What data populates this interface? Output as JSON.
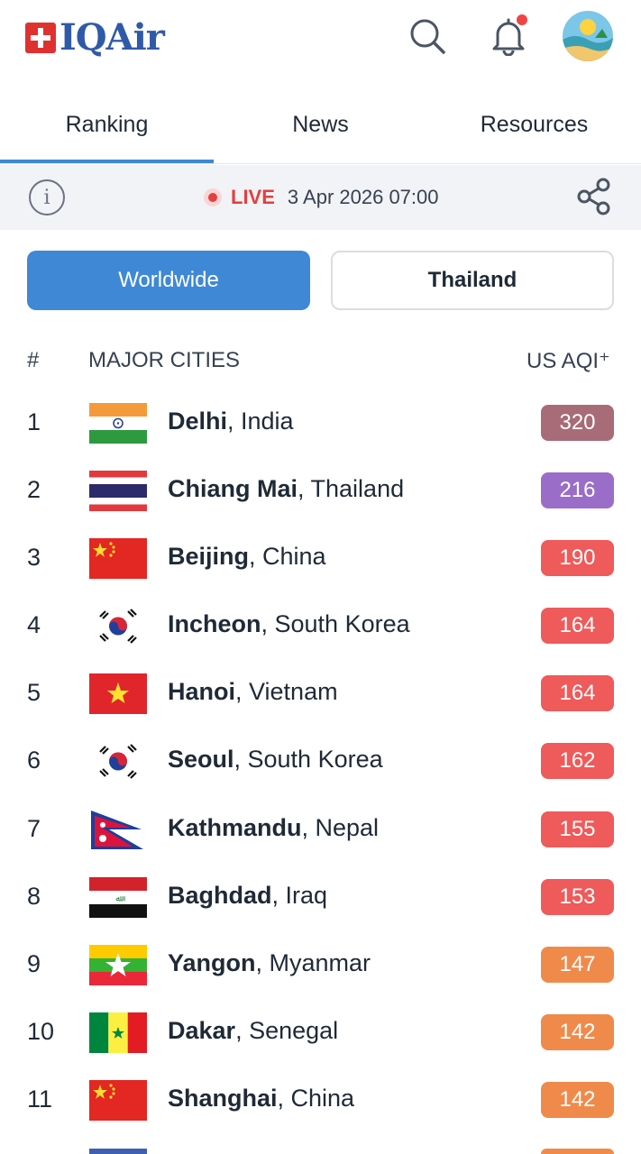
{
  "app": {
    "brand": "IQAir"
  },
  "header": {
    "icons": [
      "search-icon",
      "bell-icon",
      "avatar"
    ],
    "notification_dot_color": "#ef4444"
  },
  "tabs": [
    {
      "label": "Ranking",
      "active": true
    },
    {
      "label": "News",
      "active": false
    },
    {
      "label": "Resources",
      "active": false
    }
  ],
  "status": {
    "live_label": "LIVE",
    "timestamp": "3 Apr 2026 07:00"
  },
  "segment": {
    "worldwide": "Worldwide",
    "country": "Thailand",
    "selected": "Worldwide"
  },
  "table": {
    "col_rank": "#",
    "col_city": "MAJOR CITIES",
    "col_aqi": "US AQI⁺",
    "rows": [
      {
        "rank": "1",
        "city": "Delhi",
        "country": ", India",
        "aqi": "320",
        "flag": "india",
        "color": "#a86b78"
      },
      {
        "rank": "2",
        "city": "Chiang Mai",
        "country": ", Thailand",
        "aqi": "216",
        "flag": "thailand",
        "color": "#9a6dc9"
      },
      {
        "rank": "3",
        "city": "Beijing",
        "country": ", China",
        "aqi": "190",
        "flag": "china",
        "color": "#ef5a5a"
      },
      {
        "rank": "4",
        "city": "Incheon",
        "country": ", South Korea",
        "aqi": "164",
        "flag": "south-korea",
        "color": "#ef5a5a"
      },
      {
        "rank": "5",
        "city": "Hanoi",
        "country": ", Vietnam",
        "aqi": "164",
        "flag": "vietnam",
        "color": "#ef5a5a"
      },
      {
        "rank": "6",
        "city": "Seoul",
        "country": ", South Korea",
        "aqi": "162",
        "flag": "south-korea",
        "color": "#ef5a5a"
      },
      {
        "rank": "7",
        "city": "Kathmandu",
        "country": ", Nepal",
        "aqi": "155",
        "flag": "nepal",
        "color": "#ef5a5a"
      },
      {
        "rank": "8",
        "city": "Baghdad",
        "country": ", Iraq",
        "aqi": "153",
        "flag": "iraq",
        "color": "#ef5a5a"
      },
      {
        "rank": "9",
        "city": "Yangon",
        "country": ", Myanmar",
        "aqi": "147",
        "flag": "myanmar",
        "color": "#f08a4b"
      },
      {
        "rank": "10",
        "city": "Dakar",
        "country": ", Senegal",
        "aqi": "142",
        "flag": "senegal",
        "color": "#f08a4b"
      },
      {
        "rank": "11",
        "city": "Shanghai",
        "country": ", China",
        "aqi": "142",
        "flag": "china",
        "color": "#f08a4b"
      }
    ]
  },
  "colors": {
    "accent": "#3f88d6",
    "live": "#e53e3e",
    "brand_text": "#2f5aa8"
  }
}
